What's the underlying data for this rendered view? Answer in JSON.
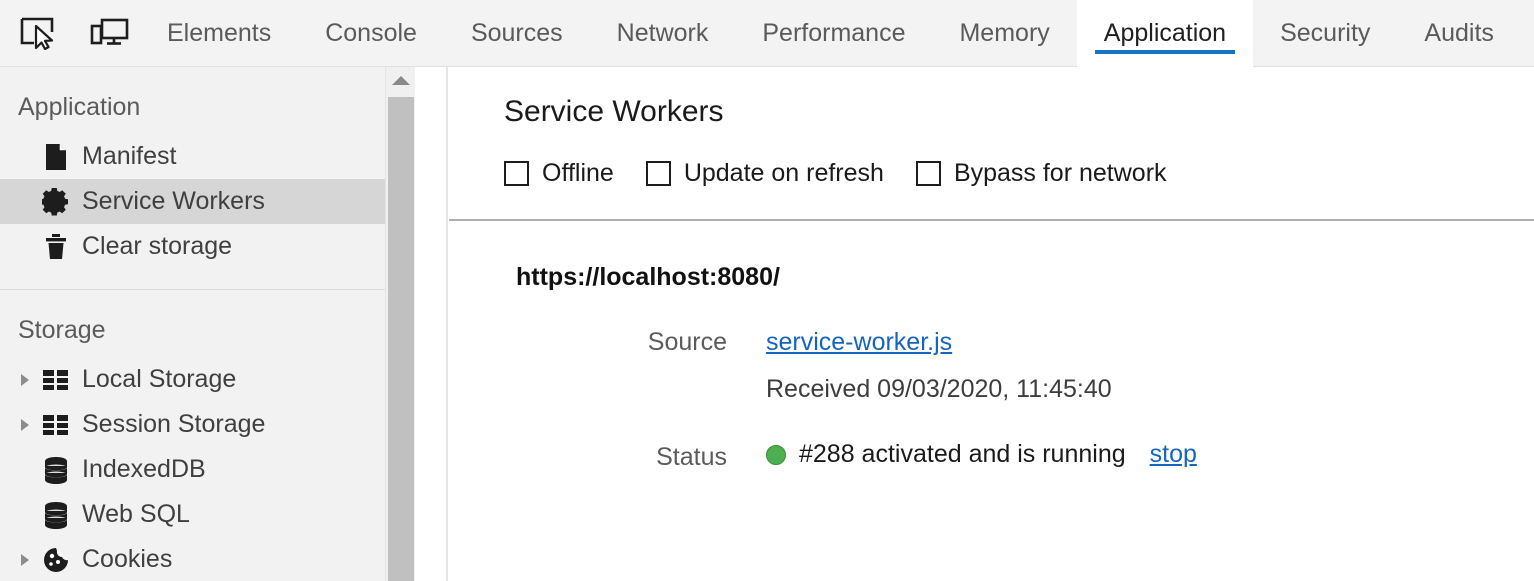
{
  "toolbar": {
    "inspect_icon": "inspect-element-icon",
    "device_icon": "device-toolbar-icon"
  },
  "tabs": [
    {
      "label": "Elements",
      "active": false
    },
    {
      "label": "Console",
      "active": false
    },
    {
      "label": "Sources",
      "active": false
    },
    {
      "label": "Network",
      "active": false
    },
    {
      "label": "Performance",
      "active": false
    },
    {
      "label": "Memory",
      "active": false
    },
    {
      "label": "Application",
      "active": true
    },
    {
      "label": "Security",
      "active": false
    },
    {
      "label": "Audits",
      "active": false
    }
  ],
  "sidebar": {
    "sections": [
      {
        "title": "Application",
        "items": [
          {
            "label": "Manifest",
            "icon": "document-icon",
            "selected": false,
            "expandable": false
          },
          {
            "label": "Service Workers",
            "icon": "gear-icon",
            "selected": true,
            "expandable": false
          },
          {
            "label": "Clear storage",
            "icon": "trash-icon",
            "selected": false,
            "expandable": false
          }
        ]
      },
      {
        "title": "Storage",
        "items": [
          {
            "label": "Local Storage",
            "icon": "table-icon",
            "selected": false,
            "expandable": true
          },
          {
            "label": "Session Storage",
            "icon": "table-icon",
            "selected": false,
            "expandable": true
          },
          {
            "label": "IndexedDB",
            "icon": "database-icon",
            "selected": false,
            "expandable": false
          },
          {
            "label": "Web SQL",
            "icon": "database-icon",
            "selected": false,
            "expandable": false
          },
          {
            "label": "Cookies",
            "icon": "cookie-icon",
            "selected": false,
            "expandable": true
          }
        ]
      }
    ],
    "scrollbar": {
      "up_arrow_icon": "caret-up-icon"
    }
  },
  "main": {
    "title": "Service Workers",
    "checkboxes": [
      {
        "label": "Offline",
        "checked": false
      },
      {
        "label": "Update on refresh",
        "checked": false
      },
      {
        "label": "Bypass for network",
        "checked": false
      }
    ],
    "origin": "https://localhost:8080/",
    "source_label": "Source",
    "source_link": "service-worker.js",
    "received": "Received 09/03/2020, 11:45:40",
    "status_label": "Status",
    "status_text": "#288 activated and is running",
    "status_action": "stop",
    "status_color": "#4caf50"
  },
  "colors": {
    "accent": "#1573c8",
    "link": "#1565c0",
    "tabbar_bg": "#f3f3f3",
    "sidebar_bg": "#f2f2f2",
    "selected_bg": "#d6d6d6",
    "status_green": "#4caf50"
  }
}
